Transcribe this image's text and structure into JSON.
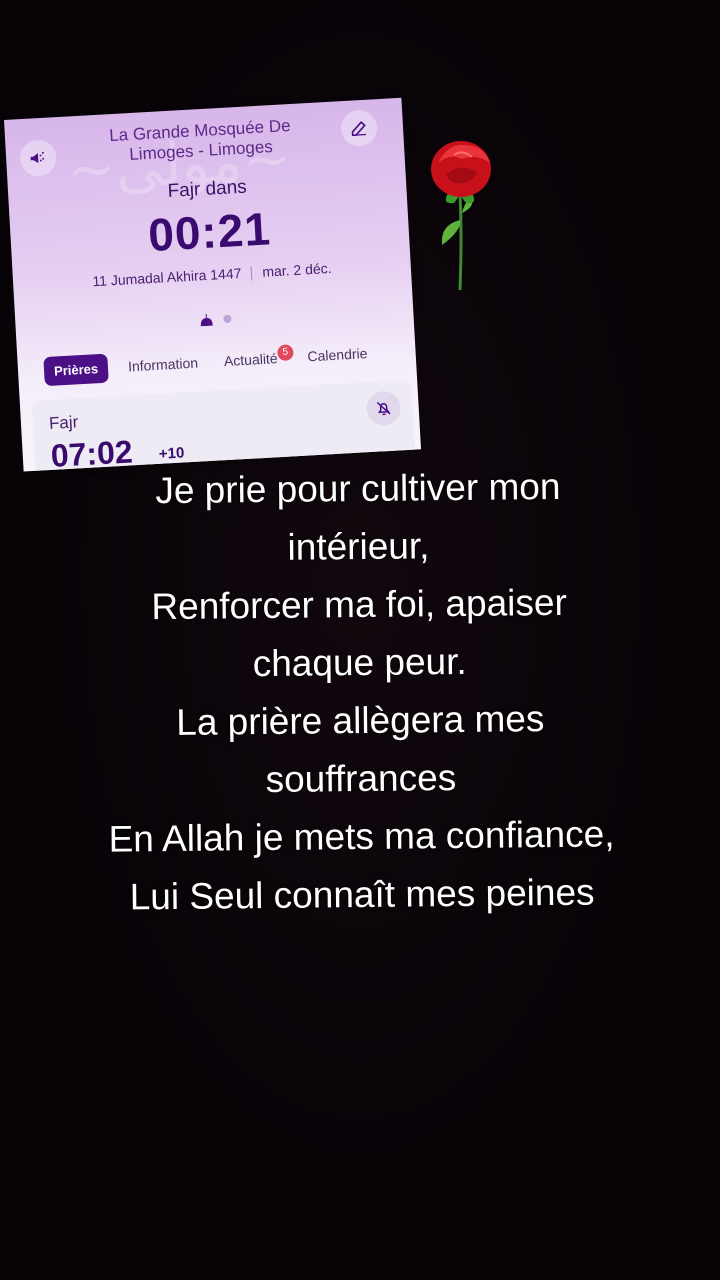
{
  "card": {
    "mosque_title_line1": "La Grande Mosquée De",
    "mosque_title_line2": "Limoges - Limoges",
    "next_prayer_label": "Fajr dans",
    "countdown": "00:21",
    "hijri_date": "11 Jumadal Akhira 1447",
    "gregorian_date": "mar. 2 déc.",
    "tabs": [
      {
        "label": "Prières",
        "active": true
      },
      {
        "label": "Information",
        "active": false
      },
      {
        "label": "Actualité",
        "active": false,
        "badge": "5"
      },
      {
        "label": "Calendrie",
        "active": false
      }
    ],
    "prayer": {
      "name": "Fajr",
      "time": "07:02",
      "offset": "+10"
    },
    "icons": {
      "left": "megaphone-icon",
      "right": "edit-icon",
      "bell": "bell-off-icon"
    },
    "colors": {
      "accent": "#4b0f86",
      "badge": "#e04a5a",
      "text_dark": "#3a0b6e"
    }
  },
  "poem": {
    "lines": [
      "Je prie pour cultiver mon",
      "intérieur,",
      "Renforcer ma foi, apaiser",
      "chaque peur.",
      "La prière allègera mes",
      "souffrances",
      "En Allah je mets ma confiance,",
      "Lui Seul connaît mes peines"
    ]
  }
}
